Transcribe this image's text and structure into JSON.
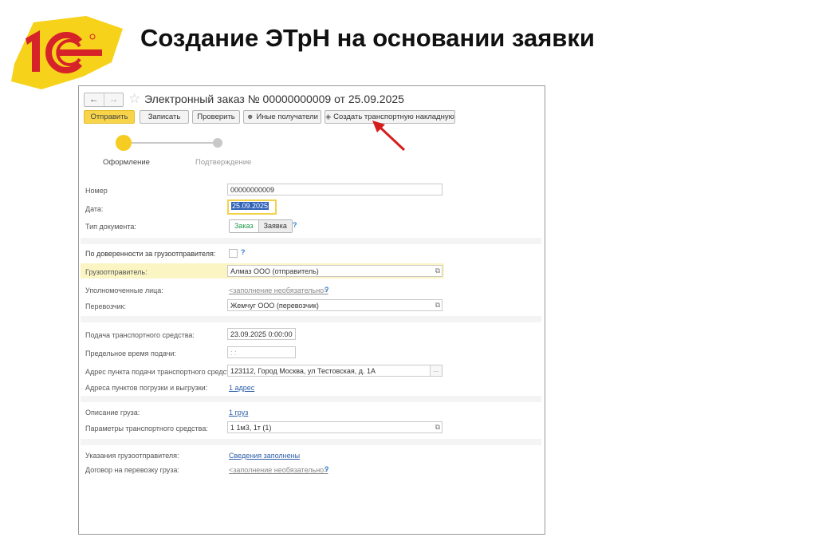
{
  "slide": {
    "title": "Создание ЭТрН на основании заявки",
    "logo_text": "1С"
  },
  "window": {
    "title": "Электронный заказ № 00000000009 от 25.09.2025",
    "nav": {
      "back": "←",
      "forward": "→",
      "favorite": "☆"
    }
  },
  "toolbar": {
    "send": "Отправить",
    "save": "Записать",
    "check": "Проверить",
    "other_recipients": "Иные получатели",
    "create_waybill": "Создать транспортную накладную"
  },
  "steps": {
    "step1": "Оформление",
    "step2": "Подтверждение"
  },
  "form": {
    "number_label": "Номер",
    "number_value": "00000000009",
    "date_label": "Дата:",
    "date_value": "25.09.2025",
    "doc_type_label": "Тип документа:",
    "doc_type_order": "Заказ",
    "doc_type_request": "Заявка",
    "proxy_label": "По доверенности за грузоотправителя:",
    "shipper_label": "Грузоотправитель:",
    "shipper_value": "Алмаз ООО (отправитель)",
    "authorized_label": "Уполномоченные лица:",
    "authorized_link": "<заполнение необязательно>",
    "carrier_label": "Перевозчик:",
    "carrier_value": "Жемчуг ООО (перевозчик)",
    "vehicle_arrival_label": "Подача транспортного средства:",
    "vehicle_arrival_value": "23.09.2025  0:00:00",
    "deadline_label": "Предельное время подачи:",
    "deadline_value": ":  :",
    "address_label": "Адрес пункта подачи транспортного средства:",
    "address_value": "123112, Город Москва, ул Тестовская, д. 1А",
    "load_points_label": "Адреса пунктов погрузки и выгрузки:",
    "load_points_link": "1 адрес",
    "cargo_desc_label": "Описание груза:",
    "cargo_desc_link": "1 груз",
    "vehicle_params_label": "Параметры транспортного средства:",
    "vehicle_params_value": "1  1м3, 1т (1)",
    "shipper_instructions_label": "Указания грузоотправителя:",
    "shipper_instructions_link": "Сведения заполнены",
    "contract_label": "Договор на перевозку груза:",
    "contract_link": "<заполнение необязательно>",
    "help": "?"
  }
}
